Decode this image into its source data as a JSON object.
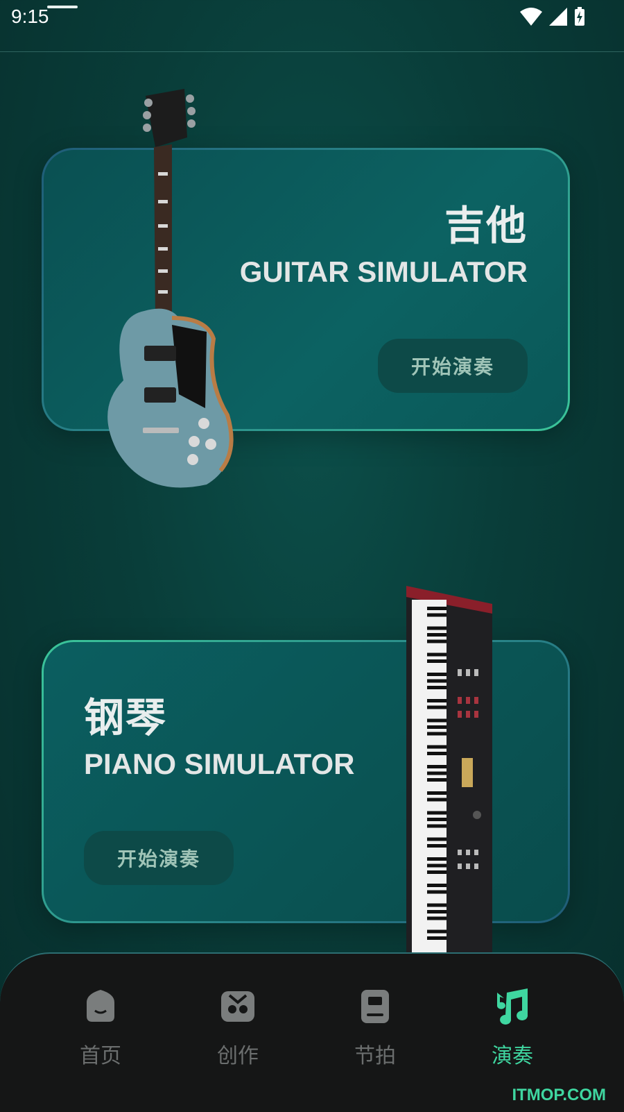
{
  "status_bar": {
    "time": "9:15"
  },
  "cards": {
    "guitar": {
      "title_cn": "吉他",
      "title_en": "GUITAR SIMULATOR",
      "button": "开始演奏"
    },
    "piano": {
      "title_cn": "钢琴",
      "title_en": "PIANO SIMULATOR",
      "button": "开始演奏"
    }
  },
  "nav": {
    "items": [
      {
        "label": "首页",
        "icon": "home-icon",
        "active": false
      },
      {
        "label": "创作",
        "icon": "create-icon",
        "active": false
      },
      {
        "label": "节拍",
        "icon": "metronome-icon",
        "active": false
      },
      {
        "label": "演奏",
        "icon": "music-note-icon",
        "active": true
      }
    ]
  },
  "watermark": "ITMOP.COM",
  "colors": {
    "accent": "#3fd6a0",
    "background": "#093d39",
    "nav_bg": "#151616"
  }
}
